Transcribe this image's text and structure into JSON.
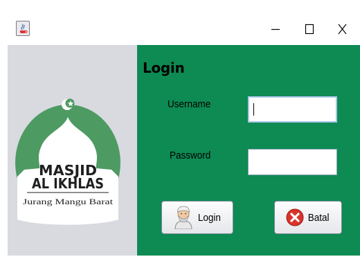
{
  "window": {
    "app_icon": "java-coffee-icon",
    "controls": {
      "minimize_icon": "minimize-icon",
      "maximize_icon": "maximize-icon",
      "close_icon": "close-icon"
    }
  },
  "logo": {
    "line1": "MASJID",
    "line2": "AL IKHLAS",
    "line3": "Jurang Mangu Barat",
    "symbol": "crescent-star-icon",
    "colors": {
      "circle": "#4e9a63",
      "dome": "#ffffff",
      "text": "#1f1f1f"
    }
  },
  "form": {
    "title": "Login",
    "username_label": "Username",
    "username_value": "",
    "password_label": "Password",
    "password_value": "",
    "panel_color": "#0e8a53"
  },
  "buttons": {
    "login_label": "Login",
    "login_icon": "man-avatar-icon",
    "cancel_label": "Batal",
    "cancel_icon": "cancel-x-icon"
  }
}
